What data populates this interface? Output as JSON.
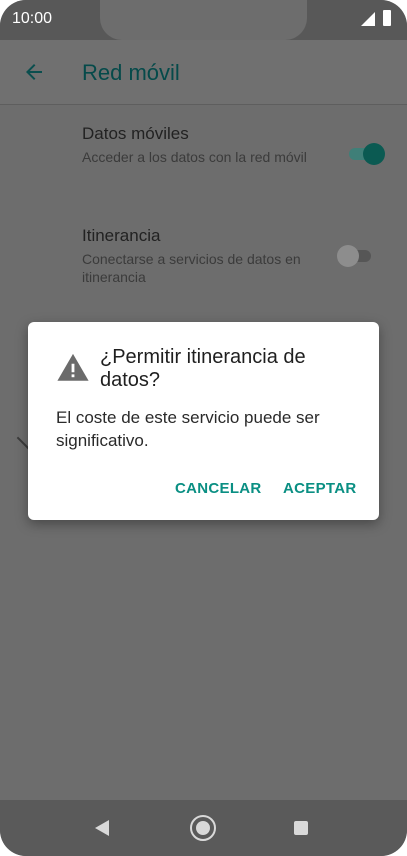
{
  "status_bar": {
    "time": "10:00"
  },
  "toolbar": {
    "title": "Red móvil"
  },
  "settings": [
    {
      "title": "Datos móviles",
      "summary": "Acceder a los datos con la red móvil",
      "switch_on": true
    },
    {
      "title": "Itinerancia",
      "summary": "Conectarse a servicios de datos en itinerancia",
      "switch_on": false
    }
  ],
  "dialog": {
    "title": "¿Permitir itinerancia de datos?",
    "message": "El coste de este servicio puede ser significativo.",
    "cancel_label": "CANCELAR",
    "accept_label": "ACEPTAR"
  },
  "colors": {
    "accent": "#0a8f83",
    "switch_on_thumb": "#0b5a52",
    "switch_on_track": "#3f7f78",
    "switch_off_thumb": "#8d8d8d",
    "switch_off_track": "#565656"
  },
  "icons": {
    "back": "arrow-left-icon",
    "warning": "warning-triangle-icon",
    "nav_back": "triangle-back-icon",
    "nav_home": "circle-home-icon",
    "nav_recent": "square-recent-icon"
  }
}
